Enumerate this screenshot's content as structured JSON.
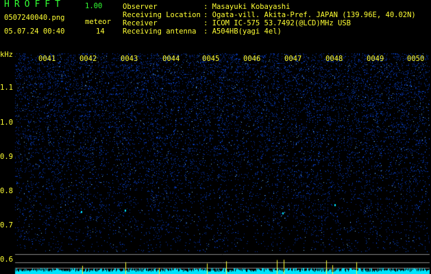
{
  "header": {
    "app_title": "HROFFT",
    "app_version": "1.00",
    "file_name": "0507240040.png",
    "detection_label": "meteor",
    "datetime": "05.07.24 00:40",
    "detection_count": "14"
  },
  "station_info": [
    {
      "label": "Observer",
      "value": ": Masayuki Kobayashi"
    },
    {
      "label": "Receiving Location",
      "value": ": Ogata-vill. Akita-Pref. JAPAN (139.96E, 40.02N)"
    },
    {
      "label": "Receiver",
      "value": ": ICOM IC-575 53.7492(@LCD)MHz USB"
    },
    {
      "label": "Receiving antenna",
      "value": ": A504HB(yagi 4el)"
    }
  ],
  "spectrogram": {
    "unit": "kHz",
    "freq_ticks": [
      "1.1",
      "1.0",
      "0.9",
      "0.8",
      "0.7",
      "0.6"
    ],
    "time_labels": [
      "0041",
      "0042",
      "0043",
      "0044",
      "0045",
      "0046",
      "0047",
      "0048",
      "0049",
      "0050"
    ],
    "colors": {
      "background": "#000000",
      "noise": "#1a3cff",
      "signal": "#00e5ff",
      "text": "#ffff33",
      "accent": "#33ff33"
    }
  }
}
